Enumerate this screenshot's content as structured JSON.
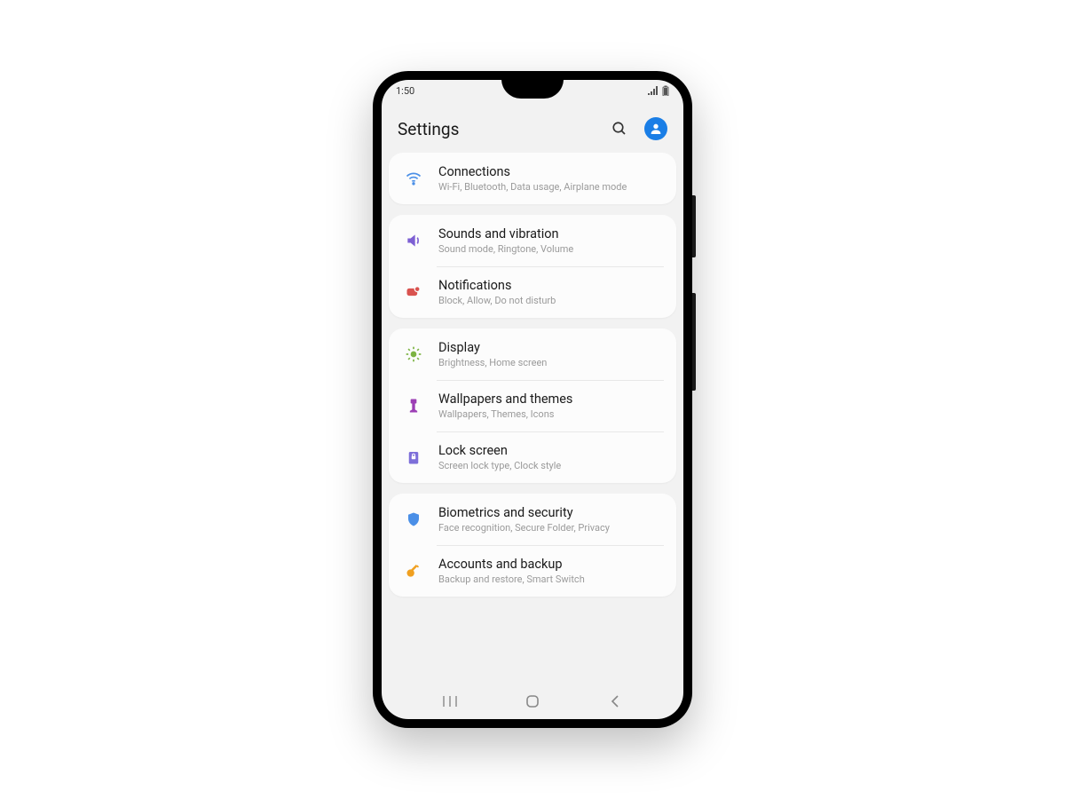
{
  "status": {
    "time": "1:50"
  },
  "header": {
    "title": "Settings"
  },
  "groups": [
    {
      "items": [
        {
          "icon": "wifi",
          "color": "#4a8fe7",
          "title": "Connections",
          "sub": "Wi-Fi, Bluetooth, Data usage, Airplane mode"
        }
      ]
    },
    {
      "items": [
        {
          "icon": "sound",
          "color": "#7d5fd3",
          "title": "Sounds and vibration",
          "sub": "Sound mode, Ringtone, Volume"
        },
        {
          "icon": "notify",
          "color": "#d9534f",
          "title": "Notifications",
          "sub": "Block, Allow, Do not disturb"
        }
      ]
    },
    {
      "items": [
        {
          "icon": "display",
          "color": "#7cb342",
          "title": "Display",
          "sub": "Brightness, Home screen"
        },
        {
          "icon": "wallpaper",
          "color": "#9c3fb5",
          "title": "Wallpapers and themes",
          "sub": "Wallpapers, Themes, Icons"
        },
        {
          "icon": "lock",
          "color": "#7d6fd9",
          "title": "Lock screen",
          "sub": "Screen lock type, Clock style"
        }
      ]
    },
    {
      "items": [
        {
          "icon": "shield",
          "color": "#4a8fe7",
          "title": "Biometrics and security",
          "sub": "Face recognition, Secure Folder, Privacy"
        },
        {
          "icon": "key",
          "color": "#f0a020",
          "title": "Accounts and backup",
          "sub": "Backup and restore, Smart Switch"
        }
      ]
    }
  ]
}
